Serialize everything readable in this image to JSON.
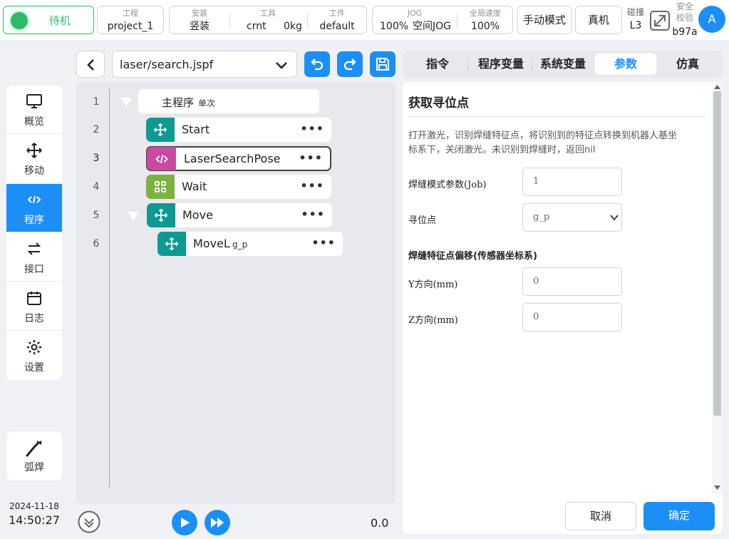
{
  "status": {
    "label": "待机",
    "color": "#2dbb6a"
  },
  "project": {
    "label": "工程",
    "value": "project_1"
  },
  "install": {
    "label": "安装",
    "value": "竖装"
  },
  "tool": {
    "label": "工具",
    "value": "crnt",
    "weight": "0kg"
  },
  "workpiece": {
    "label": "工件",
    "value": "default"
  },
  "jog": {
    "label": "JOG",
    "value": "100%",
    "mode": "空间JOG"
  },
  "speed": {
    "label": "全局速度",
    "value": "100%"
  },
  "manual_mode": "手动模式",
  "real_machine": "真机",
  "collision": {
    "label": "碰撞",
    "value": "L3"
  },
  "safety": {
    "line1": "安全",
    "line2": "校验",
    "value": "b97a"
  },
  "avatar": "A",
  "nav": [
    {
      "label": "概览",
      "icon": "monitor-icon"
    },
    {
      "label": "移动",
      "icon": "move-icon"
    },
    {
      "label": "程序",
      "icon": "code-icon"
    },
    {
      "label": "接口",
      "icon": "swap-icon"
    },
    {
      "label": "日志",
      "icon": "calendar-icon"
    },
    {
      "label": "设置",
      "icon": "gear-icon"
    }
  ],
  "weld": {
    "label": "弧焊",
    "icon": "weld-torch-icon"
  },
  "datetime": {
    "date": "2024-11-18",
    "time": "14:50:27"
  },
  "file": {
    "name": "laser/search.jspf"
  },
  "program": {
    "lines": [
      "1",
      "2",
      "3",
      "4",
      "5",
      "6"
    ],
    "main": {
      "label": "主程序",
      "sub": "单次"
    },
    "blocks": [
      {
        "label": "Start",
        "color": "#0e9a92",
        "icon": "move-icon"
      },
      {
        "label": "LaserSearchPose",
        "color": "#c94aa0",
        "icon": "code-icon"
      },
      {
        "label": "Wait",
        "color": "#7cb340",
        "icon": "grid-icon"
      },
      {
        "label": "Move",
        "color": "#0e9a92",
        "icon": "move-icon"
      },
      {
        "label": "MoveL",
        "sub": "g_p",
        "color": "#0e9a92",
        "icon": "move-icon"
      }
    ],
    "progress": "0.0"
  },
  "tabs": [
    "指令",
    "程序变量",
    "系统变量",
    "参数",
    "仿真"
  ],
  "params": {
    "title": "获取寻位点",
    "desc1": "打开激光，识别焊缝特征点，将识别到的特征点转换到机器人基坐",
    "desc2": "标系下，关闭激光。未识别到焊缝时，返回nil",
    "job_label": "焊缝模式参数(Job)",
    "job_value": "1",
    "point_label": "寻位点",
    "point_value": "g_p",
    "offset_title": "焊缝特征点偏移(传感器坐标系)",
    "y_label": "Y方向(mm)",
    "y_value": "0",
    "z_label": "Z方向(mm)",
    "z_value": "0"
  },
  "buttons": {
    "cancel": "取消",
    "ok": "确定"
  },
  "accent": "#1c8ff6"
}
